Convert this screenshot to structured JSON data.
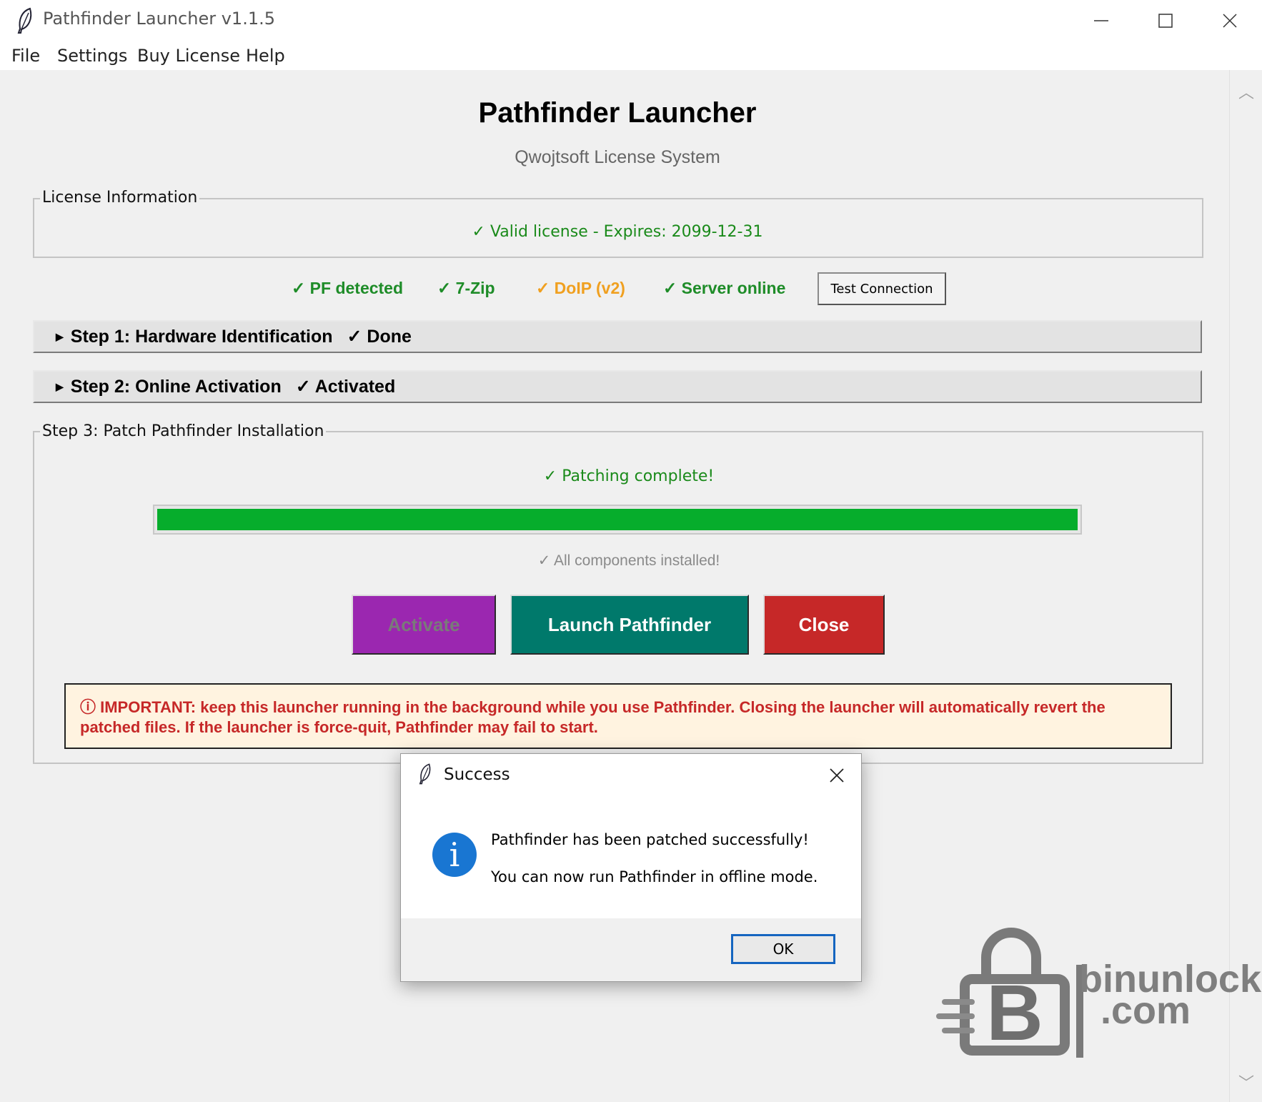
{
  "window": {
    "title": "Pathfinder Launcher v1.1.5"
  },
  "menu": [
    "File",
    "Settings",
    "Buy License",
    "Help"
  ],
  "header": {
    "title": "Pathfinder Launcher",
    "subtitle": "Qwojtsoft License System"
  },
  "license": {
    "legend": "License Information",
    "status": "✓  Valid license - Expires: 2099-12-31"
  },
  "status_bar": {
    "items": [
      {
        "text": "✓  PF detected",
        "state": "ok"
      },
      {
        "text": "✓  7-Zip",
        "state": "ok"
      },
      {
        "text": "✓  DoIP (v2)",
        "state": "warn"
      },
      {
        "text": "✓  Server online",
        "state": "ok"
      }
    ],
    "test_button": "Test Connection"
  },
  "steps": [
    {
      "label": "Step 1: Hardware Identification",
      "result": "✓ Done"
    },
    {
      "label": "Step 2: Online Activation",
      "result": "✓ Activated"
    }
  ],
  "step3": {
    "legend": "Step 3: Patch Pathfinder Installation",
    "status": "✓  Patching complete!",
    "progress": 1.0,
    "components": "✓  All components installed!",
    "buttons": {
      "activate": "Activate",
      "launch": "Launch Pathfinder",
      "close": "Close"
    },
    "important": "ⓘ IMPORTANT: keep this launcher running in the background while you use Pathfinder. Closing the launcher will automatically revert the patched files. If the launcher is force-quit, Pathfinder may fail to start."
  },
  "dialog": {
    "title": "Success",
    "message_1": "Pathfinder has been patched successfully!",
    "message_2": "You can now run Pathfinder in offline mode.",
    "ok": "OK"
  },
  "watermark": {
    "line1": "binunlock",
    "line2": ".com"
  },
  "colors": {
    "ok": "#1e8c28",
    "warn": "#f0a020",
    "progress": "#06ad2c",
    "activate": "#9b27b0",
    "launch": "#00796b",
    "close": "#c62828"
  },
  "icons": [
    "feather-icon",
    "minimize-icon",
    "maximize-icon",
    "close-icon",
    "triangle-right-icon",
    "info-icon",
    "scroll-up-icon",
    "scroll-down-icon",
    "padlock-logo-icon"
  ]
}
